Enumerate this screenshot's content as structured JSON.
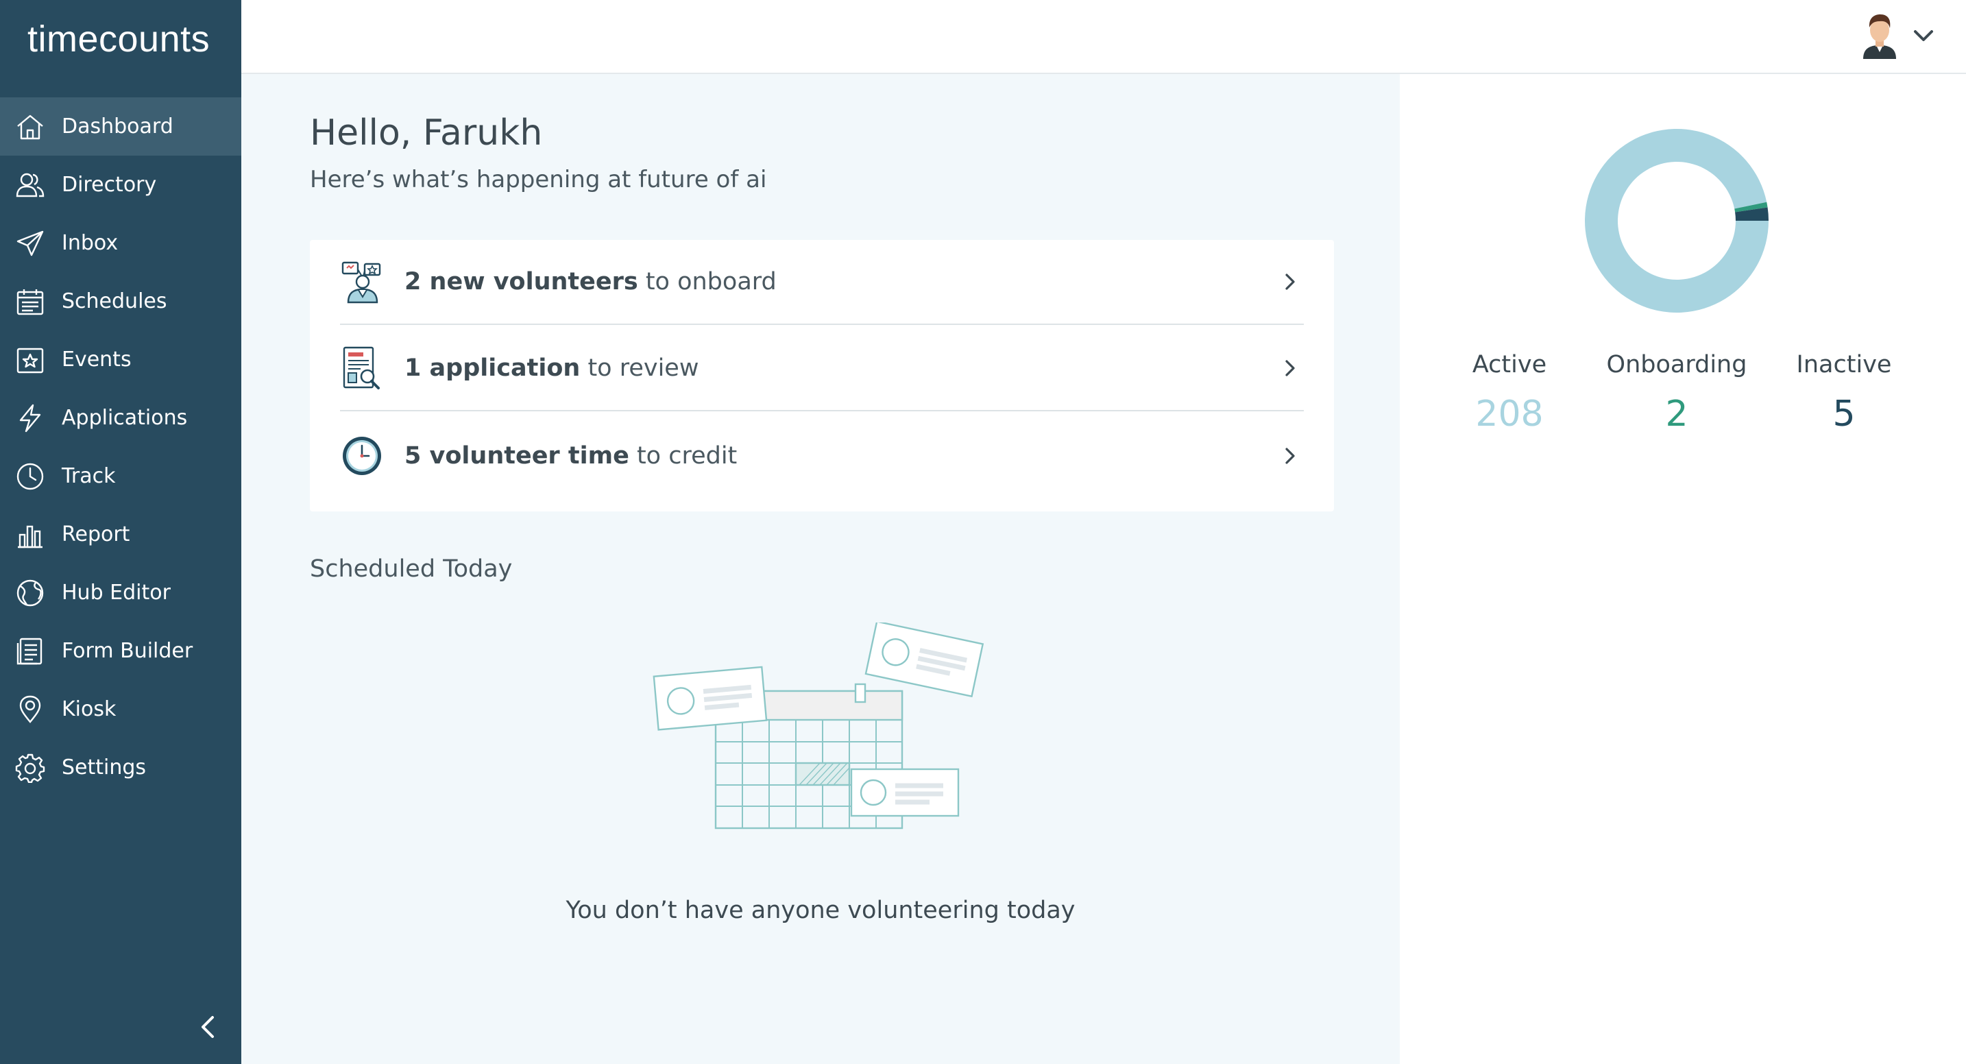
{
  "app": {
    "logo": "timecounts"
  },
  "sidebar": {
    "items": [
      {
        "label": "Dashboard",
        "icon": "home-icon",
        "active": true
      },
      {
        "label": "Directory",
        "icon": "users-icon"
      },
      {
        "label": "Inbox",
        "icon": "paper-plane-icon"
      },
      {
        "label": "Schedules",
        "icon": "calendar-icon"
      },
      {
        "label": "Events",
        "icon": "star-calendar-icon"
      },
      {
        "label": "Applications",
        "icon": "lightning-icon"
      },
      {
        "label": "Track",
        "icon": "clock-icon"
      },
      {
        "label": "Report",
        "icon": "bar-chart-icon"
      },
      {
        "label": "Hub Editor",
        "icon": "globe-icon"
      },
      {
        "label": "Form Builder",
        "icon": "form-icon"
      },
      {
        "label": "Kiosk",
        "icon": "location-pin-icon"
      },
      {
        "label": "Settings",
        "icon": "gear-icon"
      }
    ],
    "collapse_icon": "chevron-left-icon"
  },
  "header": {
    "avatar_icon": "user-avatar-icon",
    "menu_icon": "chevron-down-icon"
  },
  "main": {
    "greeting": "Hello, Farukh",
    "subgreeting": "Here’s what’s happening at future of ai",
    "tasks": [
      {
        "bold": "2 new volunteers",
        "rest": " to onboard",
        "icon": "volunteers-onboard-icon"
      },
      {
        "bold": "1 application",
        "rest": " to review",
        "icon": "application-review-icon"
      },
      {
        "bold": "5 volunteer time",
        "rest": " to credit",
        "icon": "clock-icon"
      }
    ],
    "scheduled_title": "Scheduled Today",
    "empty_message": "You don’t have anyone volunteering today"
  },
  "stats": {
    "items": [
      {
        "label": "Active",
        "value": "208",
        "color": "#a8d4e0"
      },
      {
        "label": "Onboarding",
        "value": "2",
        "color": "#2f9a7d"
      },
      {
        "label": "Inactive",
        "value": "5",
        "color": "#234a5e"
      }
    ]
  }
}
